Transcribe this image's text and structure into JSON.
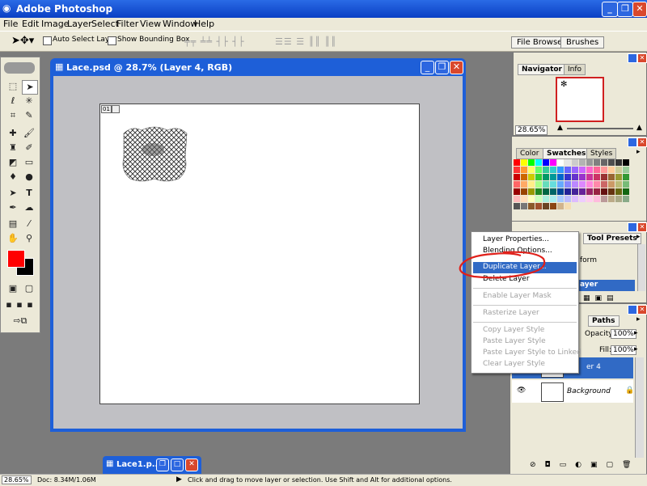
{
  "app": {
    "title": "Adobe Photoshop"
  },
  "menu": [
    "File",
    "Edit",
    "Image",
    "Layer",
    "Select",
    "Filter",
    "View",
    "Window",
    "Help"
  ],
  "options": {
    "auto_select": "Auto Select Layer",
    "show_bbox": "Show Bounding Box",
    "tab_file_browser": "File Browser",
    "tab_brushes": "Brushes"
  },
  "document": {
    "title": "Lace.psd @ 28.7% (Layer 4, RGB)",
    "corner_label": "01"
  },
  "navigator": {
    "tab_navigator": "Navigator",
    "tab_info": "Info",
    "zoom": "28.65%"
  },
  "color_panel": {
    "tab_color": "Color",
    "tab_swatches": "Swatches",
    "tab_styles": "Styles",
    "swatch_colors": [
      "#ff0000",
      "#ffff00",
      "#00ff00",
      "#00ffff",
      "#0000ff",
      "#ff00ff",
      "#ffffff",
      "#e6e6e6",
      "#cccccc",
      "#b3b3b3",
      "#999999",
      "#808080",
      "#666666",
      "#4d4d4d",
      "#333333",
      "#000000",
      "#ff3333",
      "#ff9933",
      "#ffff66",
      "#66ff66",
      "#33cc99",
      "#33cccc",
      "#3399ff",
      "#6666ff",
      "#9966ff",
      "#cc66ff",
      "#ff66cc",
      "#ff6699",
      "#ff9999",
      "#ffcc99",
      "#cccc99",
      "#99cc99",
      "#cc0000",
      "#cc6600",
      "#cccc00",
      "#33cc33",
      "#009966",
      "#009999",
      "#0066cc",
      "#3333cc",
      "#6633cc",
      "#9933cc",
      "#cc3399",
      "#cc3366",
      "#993333",
      "#996633",
      "#999933",
      "#339933",
      "#ff6666",
      "#ffaa66",
      "#ffee88",
      "#aaff88",
      "#66ddbb",
      "#66dddd",
      "#66aaff",
      "#8888ff",
      "#bb88ff",
      "#dd88ff",
      "#ff88dd",
      "#ff88aa",
      "#cc6666",
      "#cc9966",
      "#bbbb77",
      "#77bb77",
      "#990000",
      "#994400",
      "#999900",
      "#228822",
      "#006644",
      "#006666",
      "#004499",
      "#222299",
      "#442299",
      "#662299",
      "#992266",
      "#992244",
      "#661111",
      "#663311",
      "#666611",
      "#116611",
      "#ffbbbb",
      "#ffddbb",
      "#ffffbb",
      "#ccffbb",
      "#aaeedd",
      "#aaeeee",
      "#aaccff",
      "#bbbbff",
      "#ddbbff",
      "#eeccff",
      "#ffccee",
      "#ffbbdd",
      "#bb9999",
      "#bbaa88",
      "#aaaa88",
      "#88aa88",
      "#555555",
      "#777777",
      "#8b5a2b",
      "#a0522d",
      "#6b4423",
      "#8b4513",
      "#d2b48c",
      "#f5deb3"
    ]
  },
  "tool_presets": {
    "tab": "Tool Presets",
    "item": "form",
    "selected": "ayer"
  },
  "layers": {
    "tab_paths": "Paths",
    "opacity_label": "Opacity:",
    "opacity_value": "100%",
    "fill_label": "Fill:",
    "fill_value": "100%",
    "layer4": "er 4",
    "background": "Background"
  },
  "context_menu": {
    "layer_properties": "Layer Properties...",
    "blending_options": "Blending Options...",
    "duplicate_layer": "Duplicate Layer...",
    "delete_layer": "Delete Layer",
    "enable_layer_mask": "Enable Layer Mask",
    "rasterize_layer": "Rasterize Layer",
    "copy_layer_style": "Copy Layer Style",
    "paste_layer_style": "Paste Layer Style",
    "paste_layer_style_linked": "Paste Layer Style to Linked",
    "clear_layer_style": "Clear Layer Style"
  },
  "minimized": {
    "title": "Lace1.p..."
  },
  "status": {
    "zoom": "28.65%",
    "doc": "Doc: 8.34M/1.06M",
    "hint": "Click and drag to move layer or selection.  Use Shift and Alt for additional options."
  },
  "colors": {
    "foreground": "#ff0000",
    "background": "#000000",
    "highlight": "#316ac5",
    "annotation": "#e0201a"
  }
}
